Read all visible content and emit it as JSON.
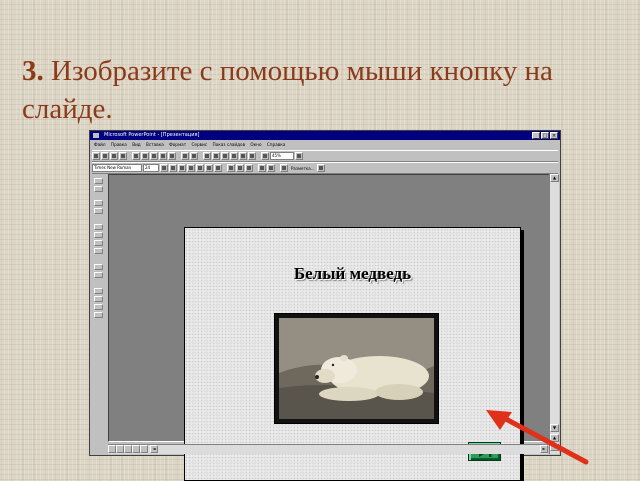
{
  "heading": {
    "number": "3.",
    "text": "Изобразите с помощью мыши кнопку на слайде."
  },
  "window": {
    "title": "Microsoft PowerPoint - [Презентация]",
    "controls": [
      "_",
      "□",
      "×"
    ],
    "menu": [
      "Файл",
      "Правка",
      "Вид",
      "Вставка",
      "Формат",
      "Сервис",
      "Показ слайдов",
      "Окно",
      "Справка"
    ],
    "zoom": "45%",
    "font_name": "Times New Roman",
    "font_size": "24",
    "slide_layout_button": "Разметка..."
  },
  "slide": {
    "title": "Белый медведь",
    "photo_alt": "polar bear photo"
  },
  "colors": {
    "heading": "#8b3a1a",
    "action_button": "#2e9c5a",
    "pointer_arrow": "#e0301a"
  },
  "icons": {
    "action_button": "play-next-icon",
    "pointer": "red-pointer-arrow"
  }
}
